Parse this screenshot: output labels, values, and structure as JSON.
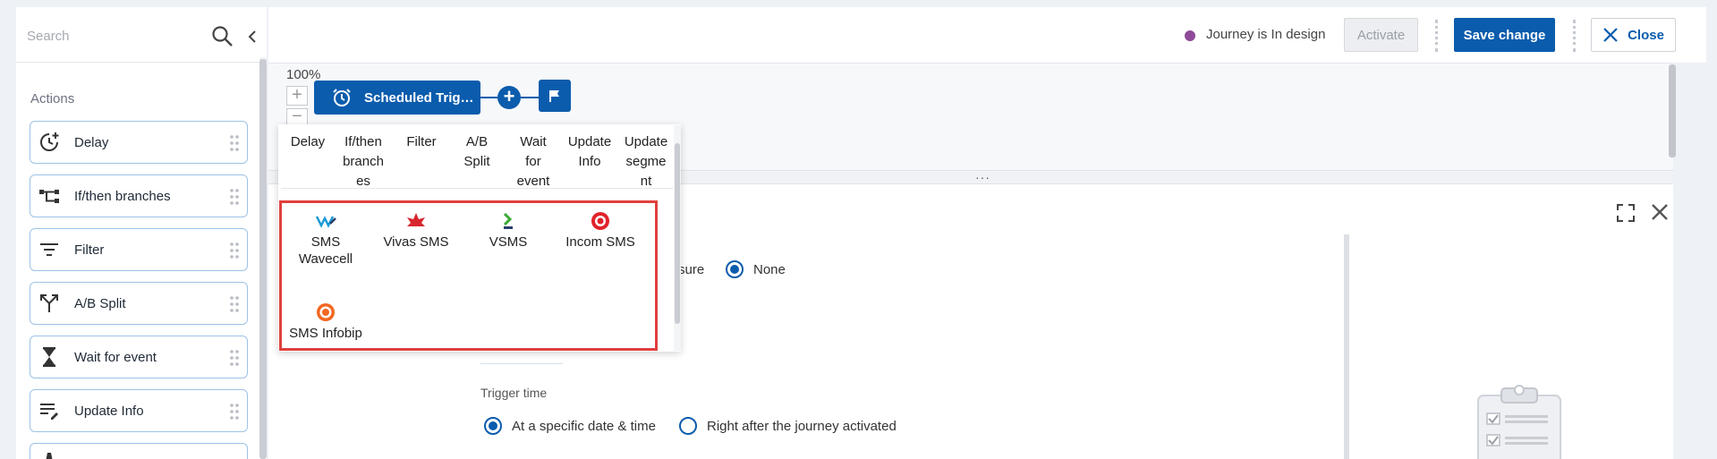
{
  "sidebar": {
    "search_placeholder": "Search",
    "actions_heading": "Actions",
    "items": [
      {
        "label": "Delay",
        "icon": "delay-icon"
      },
      {
        "label": "If/then branches",
        "icon": "branch-icon"
      },
      {
        "label": "Filter",
        "icon": "filter-icon"
      },
      {
        "label": "A/B Split",
        "icon": "split-icon"
      },
      {
        "label": "Wait for event",
        "icon": "hourglass-icon"
      },
      {
        "label": "Update Info",
        "icon": "edit-list-icon"
      }
    ]
  },
  "header": {
    "status_text": "Journey is In design",
    "status_color": "#8e4a98",
    "activate_label": "Activate",
    "save_label": "Save change",
    "close_label": "Close"
  },
  "canvas": {
    "zoom_level": "100%",
    "zoom_in": "+",
    "zoom_out": "−",
    "trigger_label": "Scheduled Trig…",
    "add_symbol": "+"
  },
  "splitter_dots": "···",
  "popover": {
    "tabs": [
      {
        "line1": "Delay",
        "line2": "",
        "line3": ""
      },
      {
        "line1": "If/then",
        "line2": "branch",
        "line3": "es"
      },
      {
        "line1": "Filter",
        "line2": "",
        "line3": ""
      },
      {
        "line1": "A/B",
        "line2": "Split",
        "line3": ""
      },
      {
        "line1": "Wait",
        "line2": "for",
        "line3": "event"
      },
      {
        "line1": "Update",
        "line2": "Info",
        "line3": ""
      },
      {
        "line1": "Update",
        "line2": "segme",
        "line3": "nt"
      }
    ],
    "channels": [
      {
        "line1": "SMS",
        "line2": "Wavecell",
        "icon": "wavecell-logo-icon",
        "color": "#1a9ad6"
      },
      {
        "line1": "Vivas SMS",
        "line2": "",
        "icon": "vivas-logo-icon",
        "color": "#d8262f"
      },
      {
        "line1": "VSMS",
        "line2": "",
        "icon": "vsms-logo-icon",
        "color": "#3aa935"
      },
      {
        "line1": "Incom SMS",
        "line2": "",
        "icon": "incom-logo-icon",
        "color": "#e2232a"
      },
      {
        "line1": "SMS Infobip",
        "line2": "",
        "icon": "infobip-logo-icon",
        "color": "#f26722"
      }
    ]
  },
  "detail": {
    "frequency_text_fragment": "sure",
    "none_label": "None",
    "trigger_time_label": "Trigger time",
    "option_specific": "At a specific date & time",
    "option_after": "Right after the journey activated"
  },
  "colors": {
    "primary": "#0b5cad",
    "highlight": "#e0403e"
  }
}
